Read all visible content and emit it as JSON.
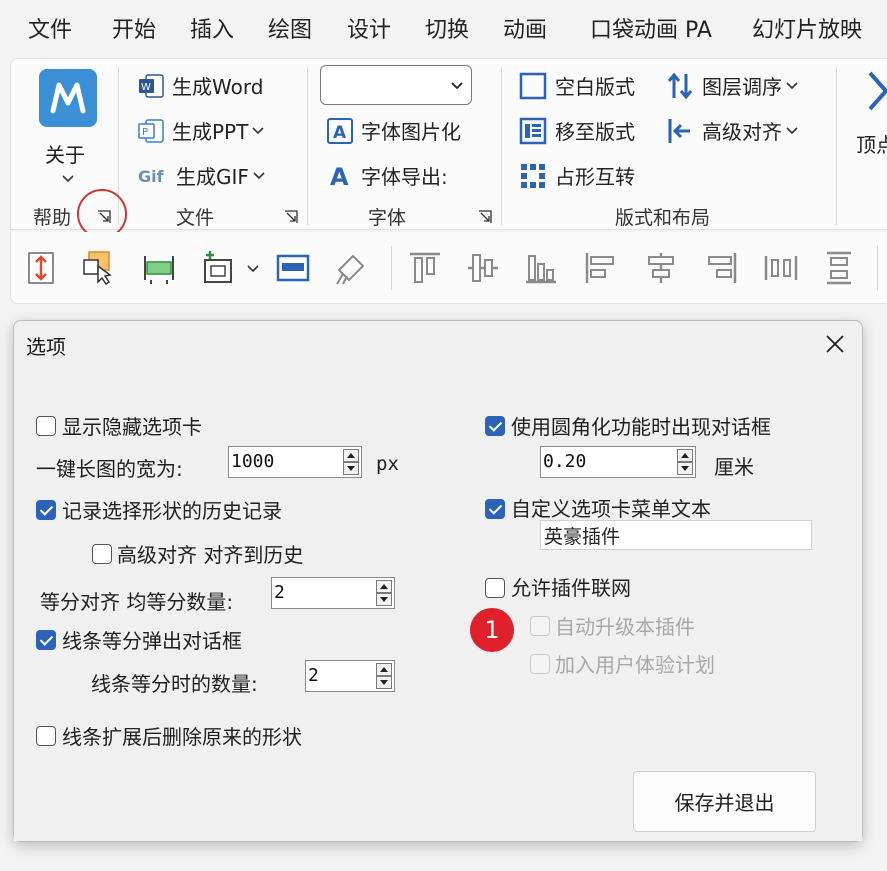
{
  "menu": {
    "tabs": [
      "文件",
      "开始",
      "插入",
      "绘图",
      "设计",
      "切换",
      "动画",
      "口袋动画 PA",
      "幻灯片放映"
    ]
  },
  "ribbon": {
    "help": {
      "about_label": "关于",
      "group_label": "帮助"
    },
    "file": {
      "gen_word": "生成Word",
      "gen_ppt": "生成PPT",
      "gen_gif": "生成GIF",
      "group_label": "文件"
    },
    "font": {
      "font_img": "字体图片化",
      "font_export": "字体导出:",
      "group_label": "字体"
    },
    "layout": {
      "blank_layout": "空白版式",
      "move_layout": "移至版式",
      "placeholder_swap": "占形互转",
      "layer_order": "图层调序",
      "adv_align": "高级对齐",
      "group_label": "版式和布局"
    },
    "vertex_label": "顶点"
  },
  "dialog": {
    "title": "选项",
    "left": {
      "show_hidden_tab": "显示隐藏选项卡",
      "long_img_width_label": "一键长图的宽为:",
      "long_img_width": "1000",
      "long_img_unit": "px",
      "record_history": "记录选择形状的历史记录",
      "adv_align_history": "高级对齐  对齐到历史",
      "equal_align_label": "等分对齐  均等分数量:",
      "equal_align_count": "2",
      "line_equal_dialog": "线条等分弹出对话框",
      "line_equal_count_label": "线条等分时的数量:",
      "line_equal_count": "2",
      "line_extend_delete": "线条扩展后删除原来的形状"
    },
    "right": {
      "round_dialog": "使用圆角化功能时出现对话框",
      "round_value": "0.20",
      "round_unit": "厘米",
      "custom_tab_text": "自定义选项卡菜单文本",
      "custom_tab_value": "英豪插件",
      "allow_network": "允许插件联网",
      "auto_upgrade": "自动升级本插件",
      "join_ux": "加入用户体验计划"
    },
    "save_button": "保存并退出"
  },
  "annotation": {
    "step": "1"
  },
  "colors": {
    "accent": "#2a63b8",
    "badge": "#e0212c",
    "help_icon": "#3a8fd6"
  }
}
